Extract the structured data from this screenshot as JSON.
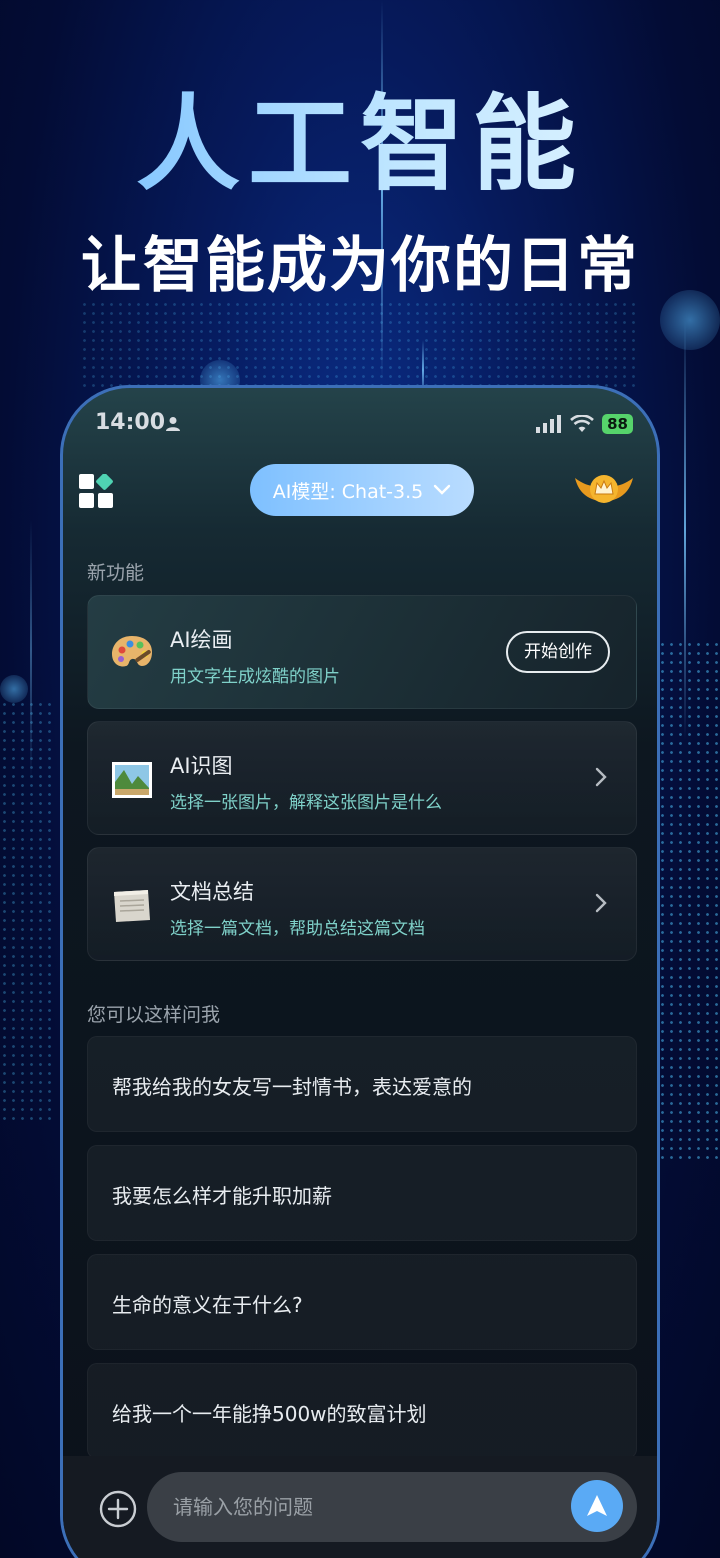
{
  "hero": {
    "title": "人工智能",
    "subtitle": "让智能成为你的日常"
  },
  "status_bar": {
    "time": "14:00",
    "battery": "88",
    "icons": [
      "person-icon",
      "signal-icon",
      "wifi-icon",
      "battery-charging-icon"
    ]
  },
  "header": {
    "menu_icon": "grid-icon",
    "model_label": "AI模型: Chat-3.5",
    "model_chevron": "chevron-down-icon",
    "vip_icon": "crown-badge-icon"
  },
  "new_features": {
    "label": "新功能",
    "items": [
      {
        "title": "AI绘画",
        "desc": "用文字生成炫酷的图片",
        "action": "开始创作",
        "icon": "palette-icon"
      },
      {
        "title": "AI识图",
        "desc": "选择一张图片，解释这张图片是什么",
        "icon": "picture-icon"
      },
      {
        "title": "文档总结",
        "desc": "选择一篇文档，帮助总结这篇文档",
        "icon": "document-icon"
      }
    ]
  },
  "suggestions": {
    "label": "您可以这样问我",
    "items": [
      "帮我给我的女友写一封情书，表达爱意的",
      "我要怎么样才能升职加薪",
      "生命的意义在于什么?",
      "给我一个一年能挣500w的致富计划"
    ]
  },
  "input": {
    "placeholder": "请输入您的问题",
    "add_icon": "plus-circle-icon",
    "send_icon": "send-icon"
  },
  "colors": {
    "background": "#061a5c",
    "accent": "#5aaaf5",
    "pill": "#9ccdff",
    "desc_text": "#7fd1c9",
    "battery": "#56d36b"
  }
}
